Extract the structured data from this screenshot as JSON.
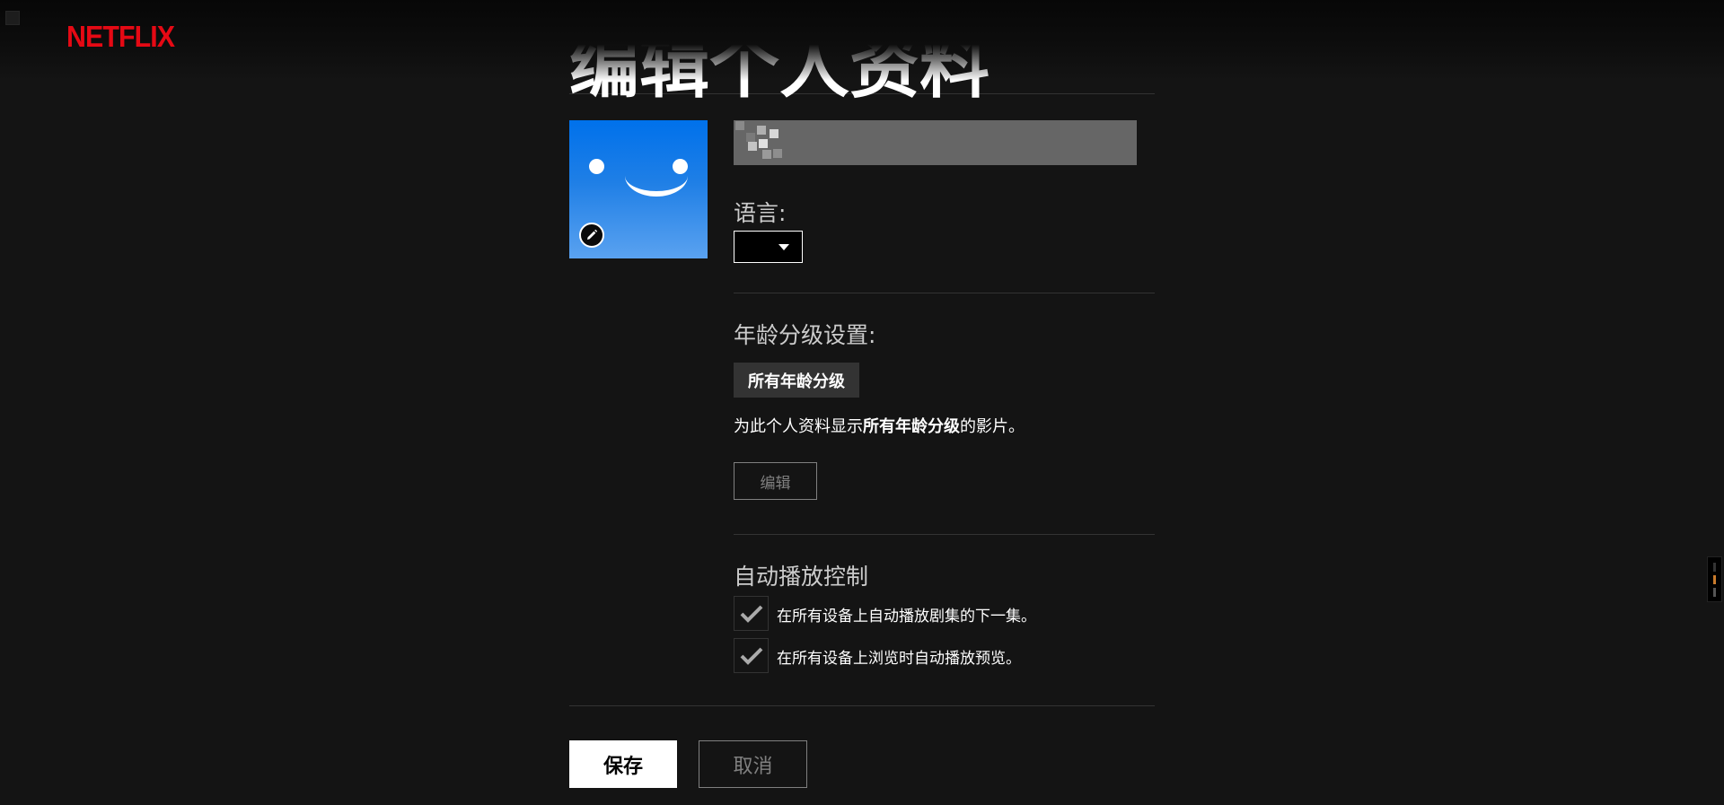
{
  "header": {
    "logo_text": "NETFLIX",
    "logo_color": "#e50914"
  },
  "page": {
    "title": "编辑个人资料"
  },
  "profile": {
    "avatar_icon": "smiley-face-avatar",
    "avatar_color": "#0071eb",
    "edit_icon": "pencil-icon",
    "name_value": ""
  },
  "language": {
    "label": "语言:",
    "selected_value": "",
    "dropdown_icon": "caret-down-icon"
  },
  "maturity": {
    "label": "年龄分级设置:",
    "rating_badge": "所有年龄分级",
    "description_prefix": "为此个人资料显示",
    "description_bold": "所有年龄分级",
    "description_suffix": "的影片。",
    "edit_label": "编辑"
  },
  "autoplay": {
    "label": "自动播放控制",
    "options": [
      {
        "label": "在所有设备上自动播放剧集的下一集。",
        "checked": true
      },
      {
        "label": "在所有设备上浏览时自动播放预览。",
        "checked": true
      }
    ]
  },
  "actions": {
    "save_label": "保存",
    "cancel_label": "取消"
  }
}
